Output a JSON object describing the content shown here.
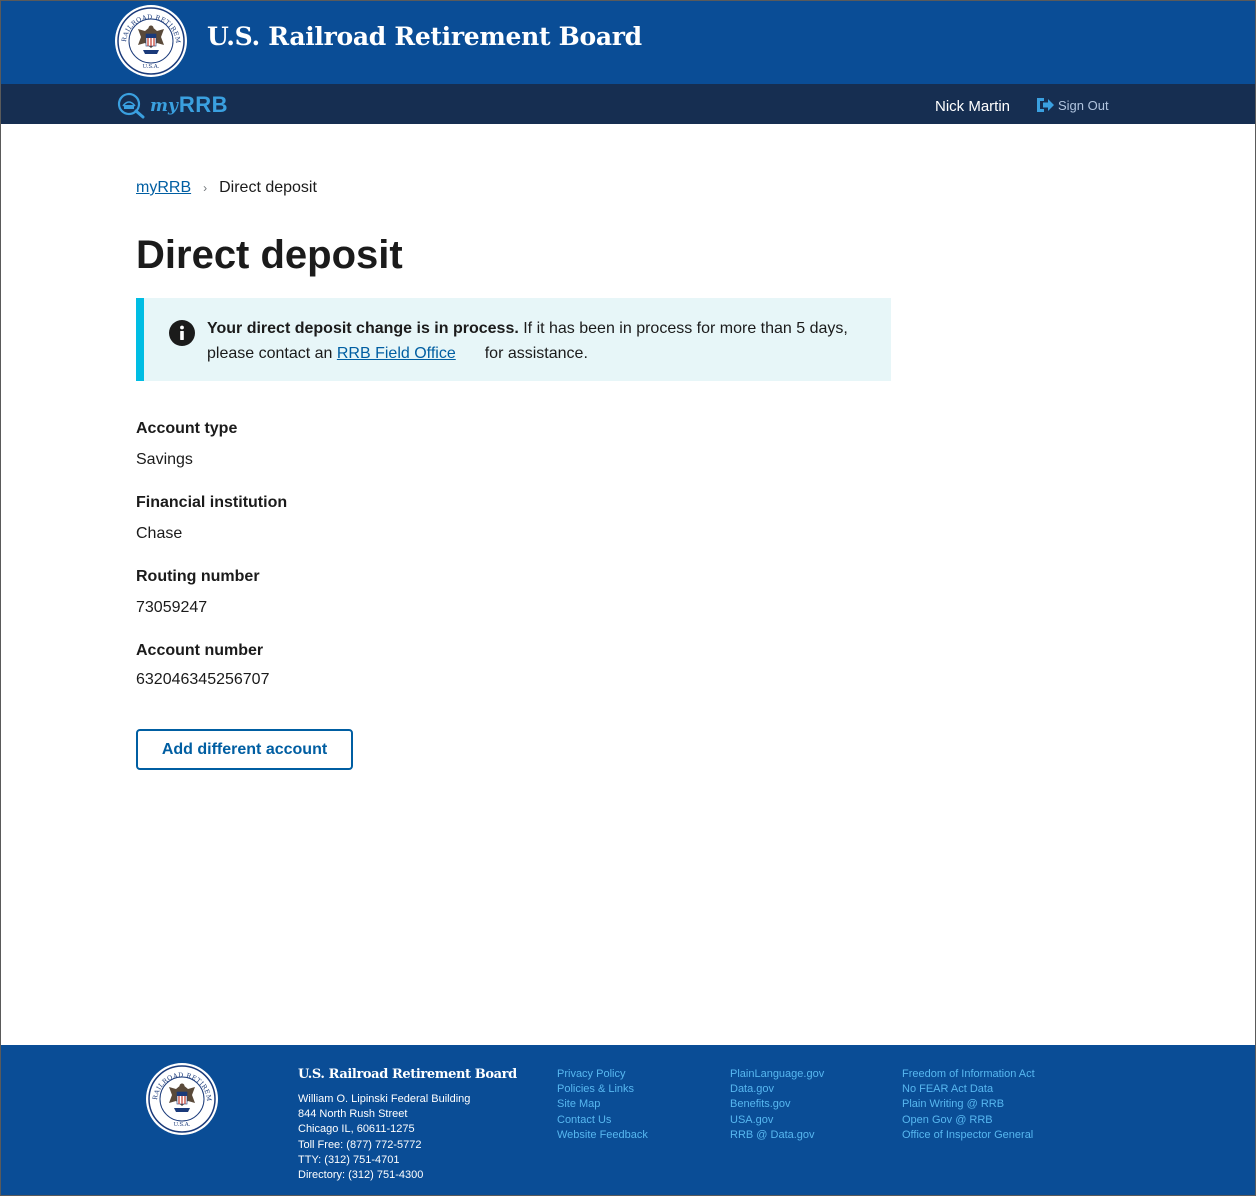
{
  "header": {
    "agency_name": "U.S. Railroad Retirement Board",
    "seal_text": "RAILROAD RETIREMENT BOARD",
    "seal_bottom": "U.S.A."
  },
  "subheader": {
    "logo_my": "my",
    "logo_rrb": "RRB",
    "user_name": "Nick Martin",
    "sign_out_label": "Sign Out"
  },
  "breadcrumb": {
    "home_label": "myRRB",
    "current_label": "Direct deposit"
  },
  "page": {
    "title": "Direct deposit"
  },
  "alert": {
    "bold_text": "Your direct deposit change is in process.",
    "text_before_link": " If it has been in process for more than 5 days, please contact an ",
    "link_text": "RRB Field Office",
    "text_after_link": "for assistance."
  },
  "fields": [
    {
      "label": "Account type",
      "value": "Savings"
    },
    {
      "label": "Financial institution",
      "value": "Chase"
    },
    {
      "label": "Routing number",
      "value": "73059247"
    },
    {
      "label": "Account number",
      "value": "632046345256707"
    }
  ],
  "actions": {
    "add_account_label": "Add different account"
  },
  "footer": {
    "title": "U.S. Railroad Retirement Board",
    "address_lines": [
      "William O. Lipinski Federal Building",
      "844 North Rush Street",
      "Chicago IL, 60611-1275",
      "Toll Free: (877) 772-5772",
      "TTY: (312) 751-4701",
      "Directory: (312) 751-4300"
    ],
    "link_col_1": [
      "Privacy Policy",
      "Policies & Links",
      "Site Map",
      "Contact Us",
      "Website Feedback"
    ],
    "link_col_2": [
      "PlainLanguage.gov",
      "Data.gov",
      "Benefits.gov",
      "USA.gov",
      "RRB @ Data.gov"
    ],
    "link_col_3": [
      "Freedom of Information Act",
      "No FEAR Act Data",
      "Plain Writing @ RRB",
      "Open Gov @ RRB",
      "Office of Inspector General"
    ]
  },
  "colors": {
    "header_blue": "#0a4d96",
    "subheader_navy": "#162e51",
    "link_blue": "#005ea2",
    "alert_bg": "#e7f6f8",
    "alert_border": "#00bde3",
    "footer_link": "#57b7f0"
  }
}
